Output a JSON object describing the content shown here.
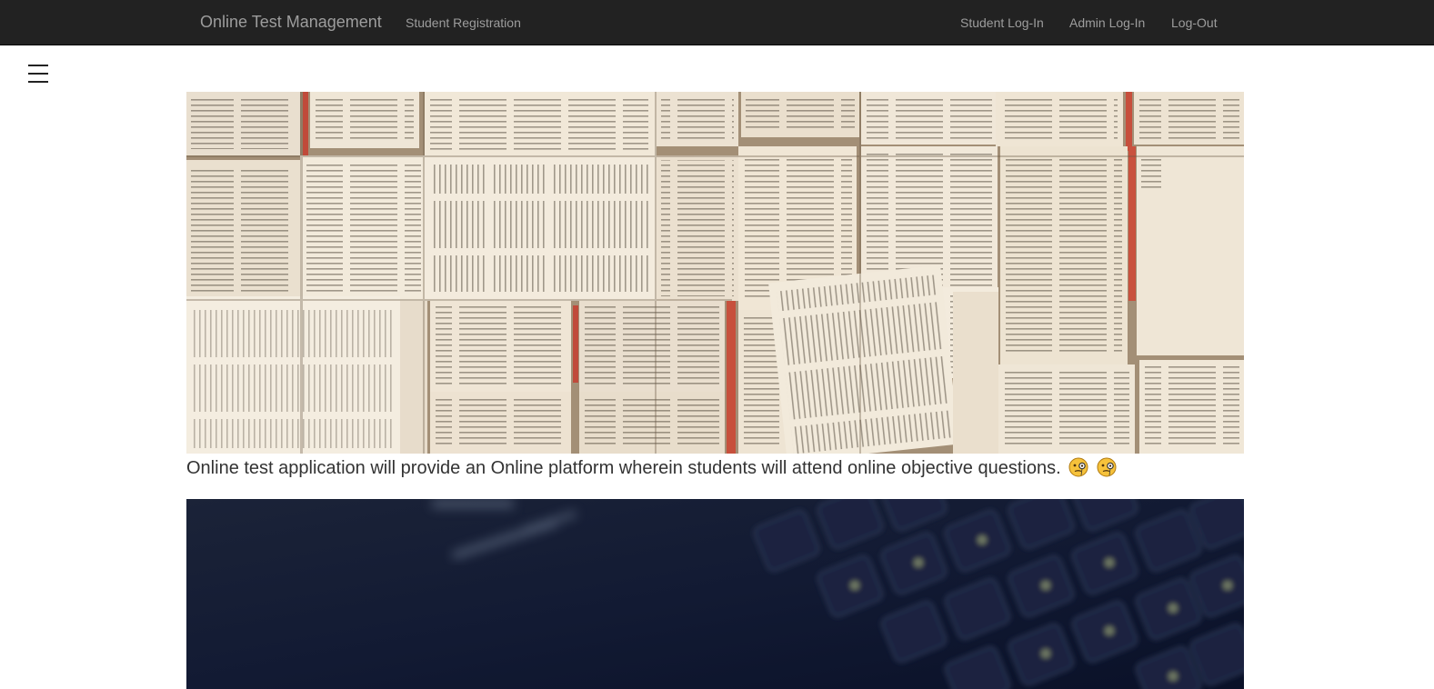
{
  "navbar": {
    "brand": "Online Test Management",
    "left_links": [
      {
        "label": "Student Registration"
      }
    ],
    "right_links": [
      {
        "label": "Student Log-In"
      },
      {
        "label": "Admin Log-In"
      },
      {
        "label": "Log-Out"
      }
    ],
    "background_color": "#222222",
    "text_color": "#9d9d9d"
  },
  "sidebar_toggle": {
    "icon": "hamburger-menu-icon"
  },
  "main": {
    "hero_image_1": {
      "subject": "books-collage-image"
    },
    "caption": "Online test application will provide an Online platform wherein students will attend online objective questions.",
    "caption_emojis": [
      "face-with-monocle-emoji",
      "face-with-monocle-emoji"
    ],
    "hero_image_2": {
      "subject": "keyboard-image"
    }
  }
}
